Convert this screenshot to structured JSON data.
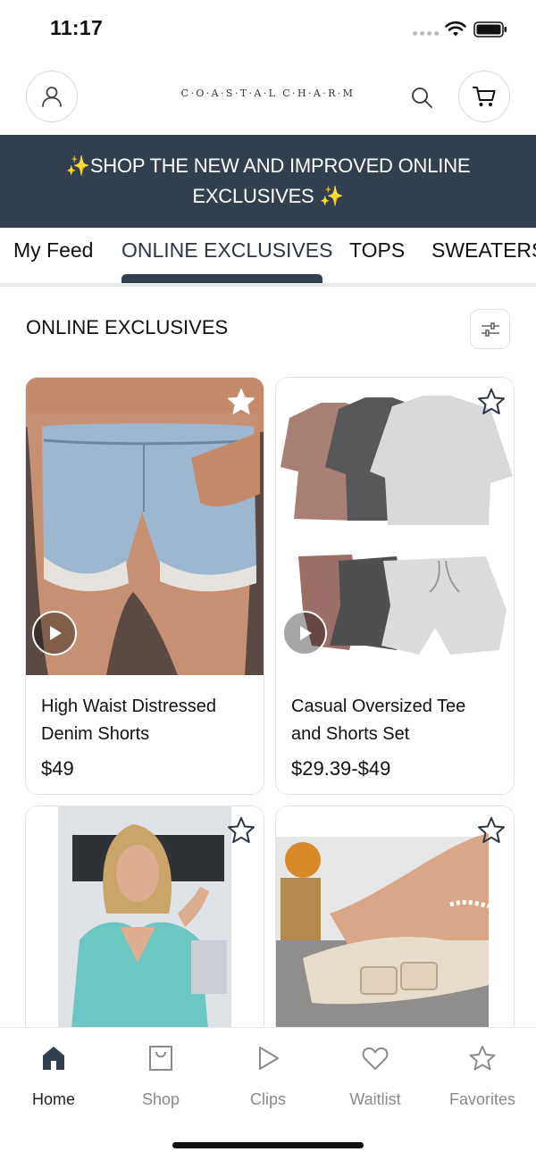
{
  "status_bar": {
    "time": "11:17"
  },
  "header": {
    "logo_text": "C·O·A·S·T·A·L  C·H·A·R·M"
  },
  "banner": {
    "text": "✨SHOP THE NEW AND IMPROVED ONLINE EXCLUSIVES ✨"
  },
  "tabs": [
    {
      "label": "My Feed"
    },
    {
      "label": "ONLINE EXCLUSIVES",
      "active": true
    },
    {
      "label": "TOPS"
    },
    {
      "label": "SWEATERS"
    }
  ],
  "section": {
    "title": "ONLINE EXCLUSIVES"
  },
  "products": [
    {
      "name": "High Waist Distressed Denim Shorts",
      "price": "$49",
      "has_video": true,
      "favorited": true
    },
    {
      "name": "Casual Oversized Tee and Shorts Set",
      "price": "$29.39-$49",
      "has_video": true,
      "favorited": false
    },
    {
      "name": "",
      "price": "",
      "has_video": false,
      "favorited": false
    },
    {
      "name": "",
      "price": "",
      "has_video": false,
      "favorited": false
    }
  ],
  "bottom_nav": [
    {
      "label": "Home",
      "icon": "home-icon",
      "active": true
    },
    {
      "label": "Shop",
      "icon": "shopping-bag-icon"
    },
    {
      "label": "Clips",
      "icon": "play-icon"
    },
    {
      "label": "Waitlist",
      "icon": "heart-icon"
    },
    {
      "label": "Favorites",
      "icon": "star-icon"
    }
  ],
  "colors": {
    "brand_navy": "#323f4f",
    "inactive_gray": "#8a8a8a"
  }
}
